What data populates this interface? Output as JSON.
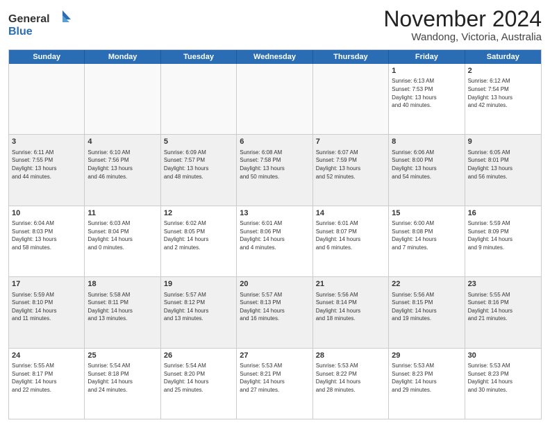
{
  "logo": {
    "general": "General",
    "blue": "Blue"
  },
  "title": "November 2024",
  "location": "Wandong, Victoria, Australia",
  "days": [
    "Sunday",
    "Monday",
    "Tuesday",
    "Wednesday",
    "Thursday",
    "Friday",
    "Saturday"
  ],
  "rows": [
    [
      {
        "day": "",
        "info": ""
      },
      {
        "day": "",
        "info": ""
      },
      {
        "day": "",
        "info": ""
      },
      {
        "day": "",
        "info": ""
      },
      {
        "day": "",
        "info": ""
      },
      {
        "day": "1",
        "info": "Sunrise: 6:13 AM\nSunset: 7:53 PM\nDaylight: 13 hours\nand 40 minutes."
      },
      {
        "day": "2",
        "info": "Sunrise: 6:12 AM\nSunset: 7:54 PM\nDaylight: 13 hours\nand 42 minutes."
      }
    ],
    [
      {
        "day": "3",
        "info": "Sunrise: 6:11 AM\nSunset: 7:55 PM\nDaylight: 13 hours\nand 44 minutes."
      },
      {
        "day": "4",
        "info": "Sunrise: 6:10 AM\nSunset: 7:56 PM\nDaylight: 13 hours\nand 46 minutes."
      },
      {
        "day": "5",
        "info": "Sunrise: 6:09 AM\nSunset: 7:57 PM\nDaylight: 13 hours\nand 48 minutes."
      },
      {
        "day": "6",
        "info": "Sunrise: 6:08 AM\nSunset: 7:58 PM\nDaylight: 13 hours\nand 50 minutes."
      },
      {
        "day": "7",
        "info": "Sunrise: 6:07 AM\nSunset: 7:59 PM\nDaylight: 13 hours\nand 52 minutes."
      },
      {
        "day": "8",
        "info": "Sunrise: 6:06 AM\nSunset: 8:00 PM\nDaylight: 13 hours\nand 54 minutes."
      },
      {
        "day": "9",
        "info": "Sunrise: 6:05 AM\nSunset: 8:01 PM\nDaylight: 13 hours\nand 56 minutes."
      }
    ],
    [
      {
        "day": "10",
        "info": "Sunrise: 6:04 AM\nSunset: 8:03 PM\nDaylight: 13 hours\nand 58 minutes."
      },
      {
        "day": "11",
        "info": "Sunrise: 6:03 AM\nSunset: 8:04 PM\nDaylight: 14 hours\nand 0 minutes."
      },
      {
        "day": "12",
        "info": "Sunrise: 6:02 AM\nSunset: 8:05 PM\nDaylight: 14 hours\nand 2 minutes."
      },
      {
        "day": "13",
        "info": "Sunrise: 6:01 AM\nSunset: 8:06 PM\nDaylight: 14 hours\nand 4 minutes."
      },
      {
        "day": "14",
        "info": "Sunrise: 6:01 AM\nSunset: 8:07 PM\nDaylight: 14 hours\nand 6 minutes."
      },
      {
        "day": "15",
        "info": "Sunrise: 6:00 AM\nSunset: 8:08 PM\nDaylight: 14 hours\nand 7 minutes."
      },
      {
        "day": "16",
        "info": "Sunrise: 5:59 AM\nSunset: 8:09 PM\nDaylight: 14 hours\nand 9 minutes."
      }
    ],
    [
      {
        "day": "17",
        "info": "Sunrise: 5:59 AM\nSunset: 8:10 PM\nDaylight: 14 hours\nand 11 minutes."
      },
      {
        "day": "18",
        "info": "Sunrise: 5:58 AM\nSunset: 8:11 PM\nDaylight: 14 hours\nand 13 minutes."
      },
      {
        "day": "19",
        "info": "Sunrise: 5:57 AM\nSunset: 8:12 PM\nDaylight: 14 hours\nand 13 minutes."
      },
      {
        "day": "20",
        "info": "Sunrise: 5:57 AM\nSunset: 8:13 PM\nDaylight: 14 hours\nand 16 minutes."
      },
      {
        "day": "21",
        "info": "Sunrise: 5:56 AM\nSunset: 8:14 PM\nDaylight: 14 hours\nand 18 minutes."
      },
      {
        "day": "22",
        "info": "Sunrise: 5:56 AM\nSunset: 8:15 PM\nDaylight: 14 hours\nand 19 minutes."
      },
      {
        "day": "23",
        "info": "Sunrise: 5:55 AM\nSunset: 8:16 PM\nDaylight: 14 hours\nand 21 minutes."
      }
    ],
    [
      {
        "day": "24",
        "info": "Sunrise: 5:55 AM\nSunset: 8:17 PM\nDaylight: 14 hours\nand 22 minutes."
      },
      {
        "day": "25",
        "info": "Sunrise: 5:54 AM\nSunset: 8:18 PM\nDaylight: 14 hours\nand 24 minutes."
      },
      {
        "day": "26",
        "info": "Sunrise: 5:54 AM\nSunset: 8:20 PM\nDaylight: 14 hours\nand 25 minutes."
      },
      {
        "day": "27",
        "info": "Sunrise: 5:53 AM\nSunset: 8:21 PM\nDaylight: 14 hours\nand 27 minutes."
      },
      {
        "day": "28",
        "info": "Sunrise: 5:53 AM\nSunset: 8:22 PM\nDaylight: 14 hours\nand 28 minutes."
      },
      {
        "day": "29",
        "info": "Sunrise: 5:53 AM\nSunset: 8:23 PM\nDaylight: 14 hours\nand 29 minutes."
      },
      {
        "day": "30",
        "info": "Sunrise: 5:53 AM\nSunset: 8:23 PM\nDaylight: 14 hours\nand 30 minutes."
      }
    ]
  ]
}
